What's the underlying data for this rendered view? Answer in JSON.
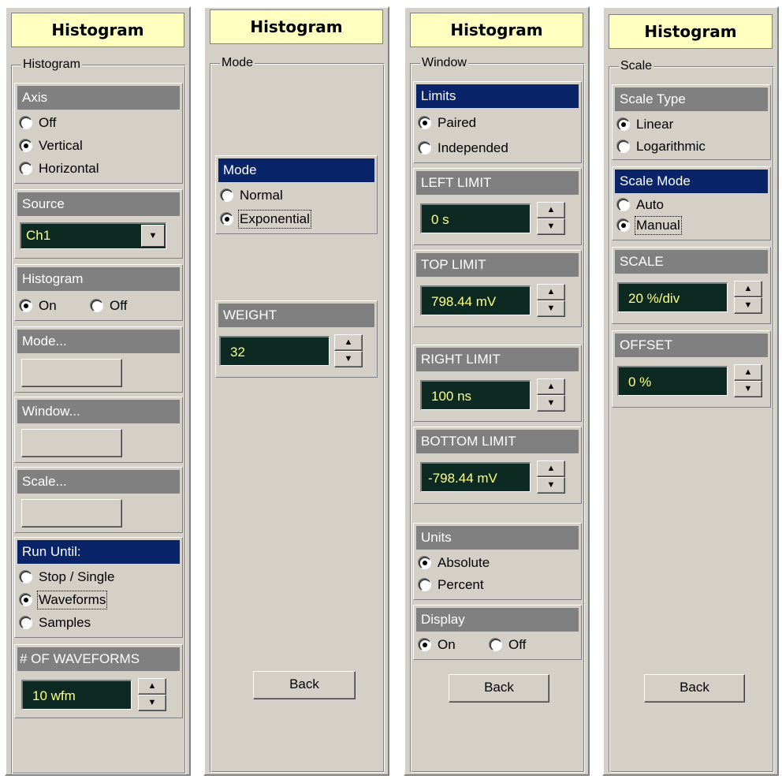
{
  "panel1": {
    "title": "Histogram",
    "frame_label": "Histogram",
    "axis": {
      "header": "Axis",
      "options": [
        "Off",
        "Vertical",
        "Horizontal"
      ],
      "selected": "Vertical"
    },
    "source": {
      "header": "Source",
      "value": "Ch1"
    },
    "histogram": {
      "header": "Histogram",
      "options": [
        "On",
        "Off"
      ],
      "selected": "On"
    },
    "mode_header": "Mode...",
    "window_header": "Window...",
    "scale_header": "Scale...",
    "run_until": {
      "header": "Run Until:",
      "options": [
        "Stop / Single",
        "Waveforms",
        "Samples"
      ],
      "selected": "Waveforms"
    },
    "num_waveforms": {
      "header": "# OF WAVEFORMS",
      "value": "10 wfm"
    }
  },
  "panel2": {
    "title": "Histogram",
    "frame_label": "Mode",
    "mode": {
      "header": "Mode",
      "options": [
        "Normal",
        "Exponential"
      ],
      "selected": "Exponential"
    },
    "weight": {
      "header": "WEIGHT",
      "value": "32"
    },
    "back_label": "Back"
  },
  "panel3": {
    "title": "Histogram",
    "frame_label": "Window",
    "limits": {
      "header": "Limits",
      "options": [
        "Paired",
        "Independed"
      ],
      "selected": "Paired"
    },
    "left_limit": {
      "header": "LEFT LIMIT",
      "value": "0 s"
    },
    "top_limit": {
      "header": "TOP LIMIT",
      "value": "798.44 mV"
    },
    "right_limit": {
      "header": "RIGHT LIMIT",
      "value": "100 ns"
    },
    "bottom_limit": {
      "header": "BOTTOM LIMIT",
      "value": "-798.44 mV"
    },
    "units": {
      "header": "Units",
      "options": [
        "Absolute",
        "Percent"
      ],
      "selected": "Absolute"
    },
    "display": {
      "header": "Display",
      "options": [
        "On",
        "Off"
      ],
      "selected": "On"
    },
    "back_label": "Back"
  },
  "panel4": {
    "title": "Histogram",
    "frame_label": "Scale",
    "scale_type": {
      "header": "Scale Type",
      "options": [
        "Linear",
        "Logarithmic"
      ],
      "selected": "Linear"
    },
    "scale_mode": {
      "header": "Scale Mode",
      "options": [
        "Auto",
        "Manual"
      ],
      "selected": "Manual"
    },
    "scale": {
      "header": "SCALE",
      "value": "20 %/div"
    },
    "offset": {
      "header": "OFFSET",
      "value": "0 %"
    },
    "back_label": "Back"
  },
  "colors": {
    "panel_bg": "#d4d0c8",
    "title_bg": "#ffffc0",
    "header_gray": "#808080",
    "header_selected": "#0a246a",
    "display_bg": "#0c2a22",
    "display_text": "#ffff80"
  },
  "icons": {
    "spin_up": "up-arrow-icon",
    "spin_down": "down-arrow-icon",
    "dropdown": "chevron-down-icon"
  }
}
